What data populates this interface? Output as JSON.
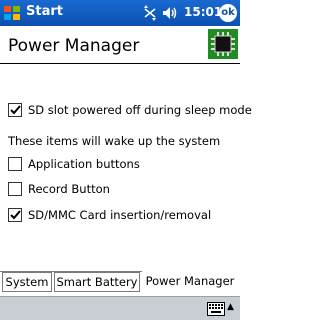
{
  "titlebar": {
    "app_title": "Start",
    "time": "15:01",
    "ok_label": "ok"
  },
  "header": {
    "title": "Power Manager"
  },
  "options": {
    "sd_sleep": {
      "label": "SD slot powered off during sleep mode",
      "checked": true
    },
    "wake_heading": "These items will wake up the system",
    "wake_items": [
      {
        "label": "Application buttons",
        "checked": false
      },
      {
        "label": "Record Button",
        "checked": false
      },
      {
        "label": "SD/MMC Card insertion/removal",
        "checked": true
      }
    ]
  },
  "tabs": [
    {
      "label": "System",
      "active": false
    },
    {
      "label": "Smart Battery",
      "active": false
    },
    {
      "label": "Power Manager",
      "active": true
    }
  ],
  "icons": {
    "start": "windows-flag-icon",
    "connectivity": "connectivity-icon",
    "volume": "volume-icon",
    "header": "chip-icon",
    "input": "keyboard-icon"
  },
  "colors": {
    "titlebar": "#0b4fb0",
    "menubar": "#c9cdd4",
    "chip": "#1e8c22"
  }
}
